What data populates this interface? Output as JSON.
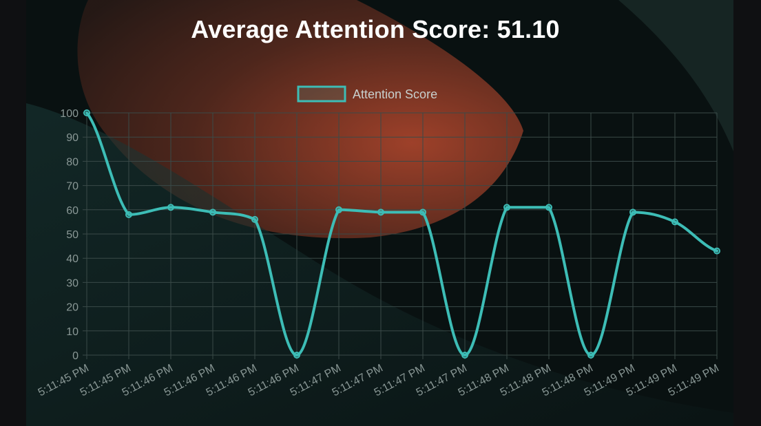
{
  "page": {
    "title": "Average Attention Score: 51.10"
  },
  "chart_data": {
    "type": "line",
    "title": "Average Attention Score: 51.10",
    "xlabel": "",
    "ylabel": "",
    "ylim": [
      0,
      100
    ],
    "yticks": [
      0,
      10,
      20,
      30,
      40,
      50,
      60,
      70,
      80,
      90,
      100
    ],
    "legend_position": "top",
    "grid": true,
    "categories": [
      "5:11:45 PM",
      "5:11:45 PM",
      "5:11:46 PM",
      "5:11:46 PM",
      "5:11:46 PM",
      "5:11:46 PM",
      "5:11:47 PM",
      "5:11:47 PM",
      "5:11:47 PM",
      "5:11:47 PM",
      "5:11:48 PM",
      "5:11:48 PM",
      "5:11:48 PM",
      "5:11:49 PM",
      "5:11:49 PM",
      "5:11:49 PM"
    ],
    "series": [
      {
        "name": "Attention Score",
        "color": "#3dbdb6",
        "values": [
          100,
          58,
          61,
          59,
          56,
          0,
          60,
          59,
          59,
          0,
          61,
          61,
          0,
          59,
          55,
          43
        ]
      }
    ]
  },
  "colors": {
    "line": "#3dbdb6",
    "grid": "#3a4a48",
    "tick_text": "#8a9896",
    "title": "#ffffff"
  }
}
